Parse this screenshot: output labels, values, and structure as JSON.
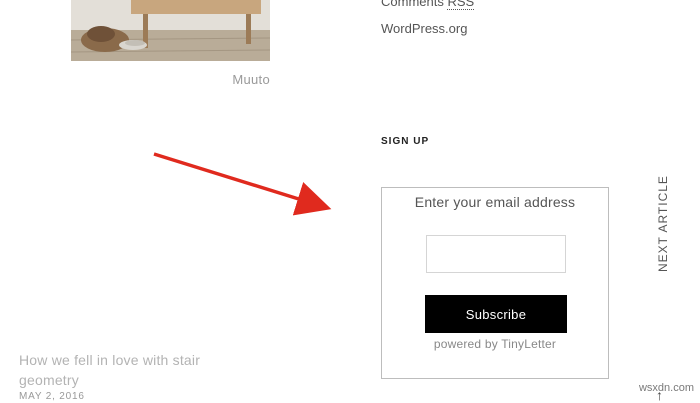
{
  "sidebar": {
    "meta_links": {
      "comments_rss_prefix": "Comments ",
      "comments_rss_abbr": "RSS",
      "wordpress_org": "WordPress.org"
    },
    "signup": {
      "heading": "SIGN UP",
      "prompt": "Enter your email address",
      "email_value": "",
      "subscribe_label": "Subscribe",
      "powered_by": "powered by TinyLetter"
    }
  },
  "featured_image": {
    "caption": "Muuto",
    "icon": "photo-of-chair-and-shoes"
  },
  "navigation": {
    "next_article_label": "NEXT ARTICLE",
    "scroll_up_icon": "up-arrow-icon",
    "scroll_up_glyph": "↑"
  },
  "next_post": {
    "title": "How we fell in love with stair geometry",
    "date": "MAY 2, 2016"
  },
  "annotation": {
    "arrow_color": "#e02a1e"
  },
  "watermark": "wsxdn.com"
}
